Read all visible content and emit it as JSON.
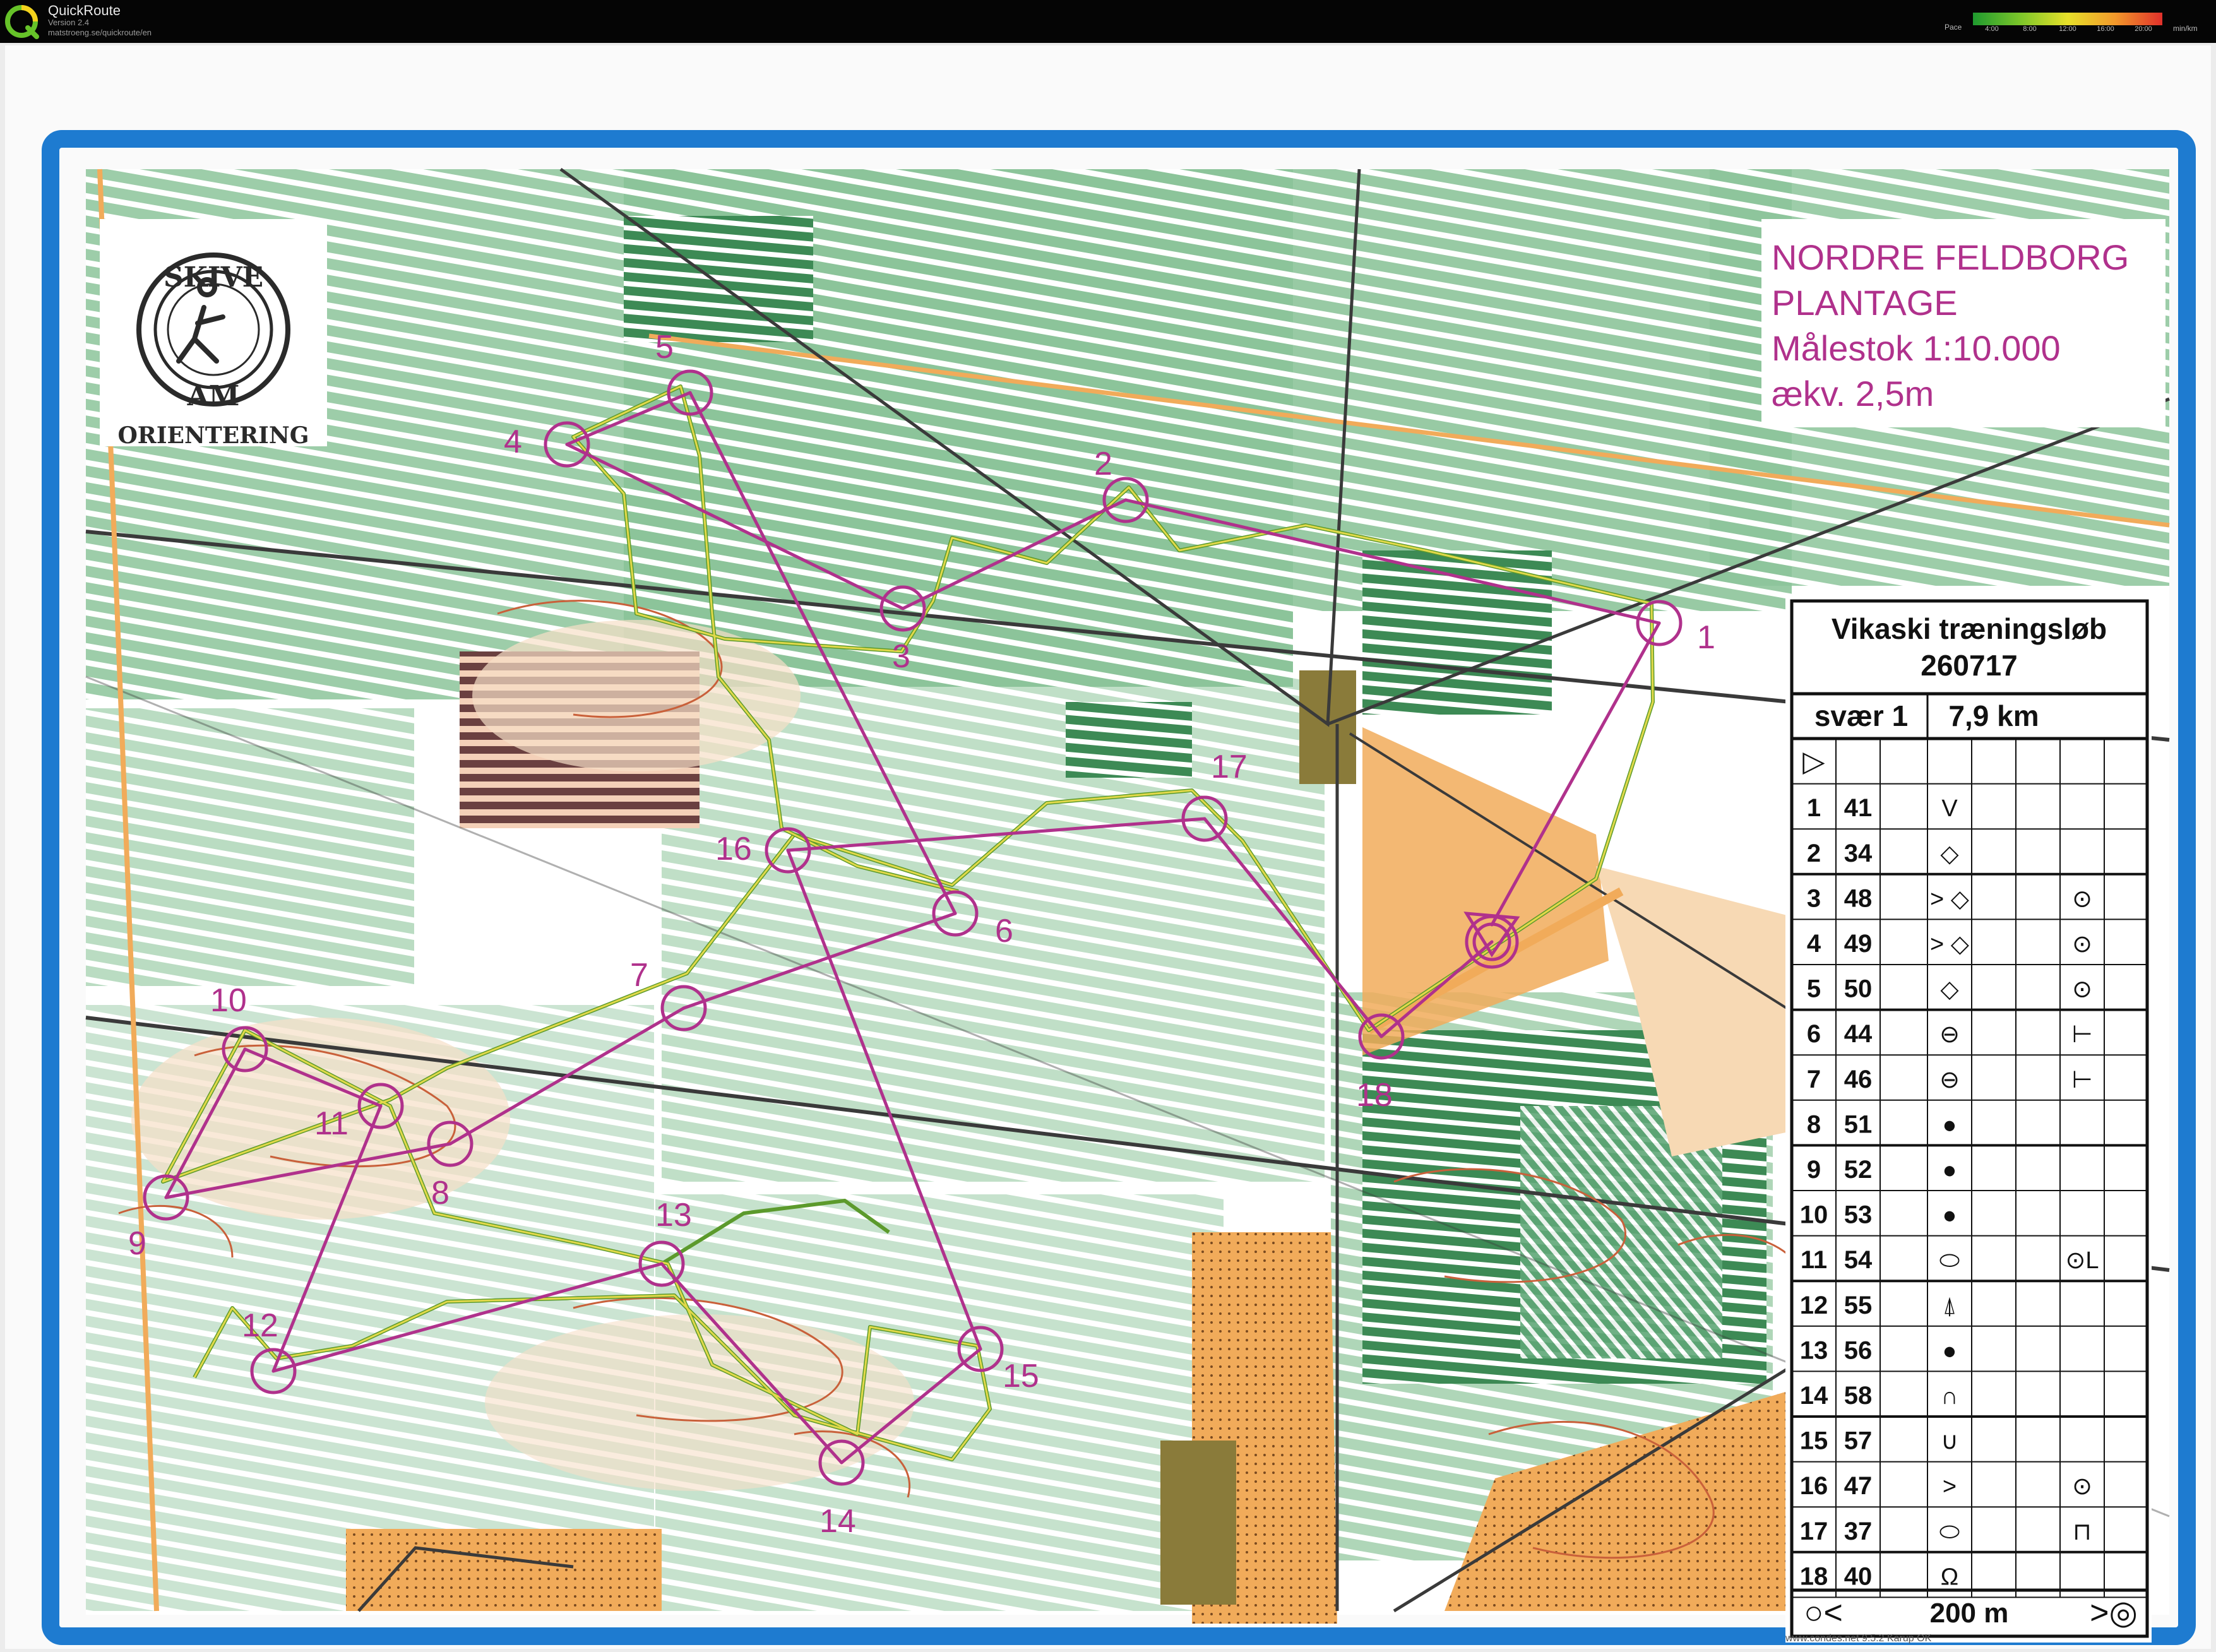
{
  "app": {
    "title": "QuickRoute",
    "version": "Version 2.4",
    "url": "matstroeng.se/quickroute/en",
    "logo_letter": "Q"
  },
  "pace_legend": {
    "label": "Pace",
    "ticks": [
      "4:00",
      "8:00",
      "12:00",
      "16:00",
      "20:00"
    ],
    "unit": "min/km",
    "colors": [
      "#1f9a2f",
      "#7cc62a",
      "#e7e02a",
      "#f2992b",
      "#e0302b"
    ]
  },
  "club_logo": {
    "top_text": "SKIVE",
    "center_text": "AM",
    "bottom_text": "ORIENTERING"
  },
  "map_title": {
    "line1": "NORDRE FELDBORG",
    "line2": "PLANTAGE",
    "line3": "Målestok 1:10.000",
    "line4": "ækv. 2,5m"
  },
  "course": {
    "event": "Vikaski træningsløb",
    "date": "260717",
    "class": "svær 1",
    "length": "7,9 km",
    "leg_distance": "200 m",
    "footer_line1": "www.condes.net 9.5.2 Karup OK",
    "footer_line2": "Vikaski træningsløb 260717",
    "controls": [
      {
        "n": "1",
        "code": "41",
        "symbol": "V",
        "extra": ""
      },
      {
        "n": "2",
        "code": "34",
        "symbol": "◇",
        "extra": ""
      },
      {
        "n": "3",
        "code": "48",
        "symbol": "> ◇",
        "extra": "⊙"
      },
      {
        "n": "4",
        "code": "49",
        "symbol": "> ◇",
        "extra": "⊙"
      },
      {
        "n": "5",
        "code": "50",
        "symbol": "◇",
        "extra": "⊙"
      },
      {
        "n": "6",
        "code": "44",
        "symbol": "⊖",
        "extra": "⊢"
      },
      {
        "n": "7",
        "code": "46",
        "symbol": "⊖",
        "extra": "⊢"
      },
      {
        "n": "8",
        "code": "51",
        "symbol": "●",
        "extra": ""
      },
      {
        "n": "9",
        "code": "52",
        "symbol": "●",
        "extra": ""
      },
      {
        "n": "10",
        "code": "53",
        "symbol": "●",
        "extra": ""
      },
      {
        "n": "11",
        "code": "54",
        "symbol": "⬭",
        "extra": "⊙L"
      },
      {
        "n": "12",
        "code": "55",
        "symbol": "⍋",
        "extra": ""
      },
      {
        "n": "13",
        "code": "56",
        "symbol": "●",
        "extra": ""
      },
      {
        "n": "14",
        "code": "58",
        "symbol": "∩",
        "extra": ""
      },
      {
        "n": "15",
        "code": "57",
        "symbol": "∪",
        "extra": ""
      },
      {
        "n": "16",
        "code": "47",
        "symbol": ">",
        "extra": "⊙"
      },
      {
        "n": "17",
        "code": "37",
        "symbol": "⬭",
        "extra": "⊓"
      },
      {
        "n": "18",
        "code": "40",
        "symbol": "Ω",
        "extra": ""
      }
    ]
  },
  "colors": {
    "course_purple": "#b0318c",
    "route_yellow": "#e2d94a",
    "route_green": "#5c9a2c",
    "frame_blue": "#1e7bd0",
    "forest_green": "#8cc49a",
    "open_yellow": "#f1ab5a",
    "contour_brown": "#c9603a"
  }
}
